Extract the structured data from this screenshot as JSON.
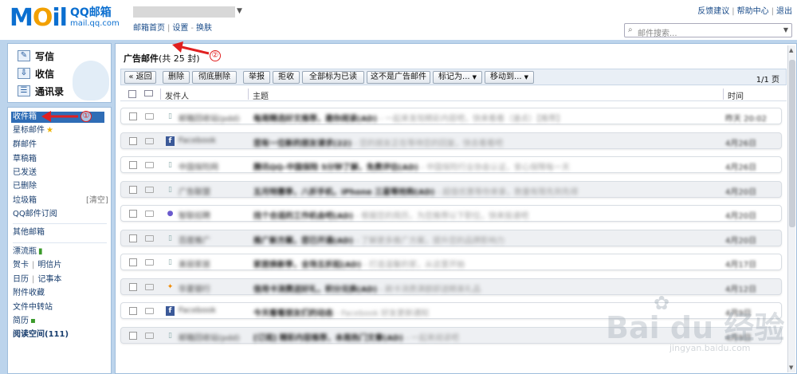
{
  "header": {
    "logo_mail": "M",
    "logo_o": "O",
    "logo_il": "il",
    "logo_cn": "QQ邮箱",
    "logo_domain": "mail.qq.com",
    "account_links": [
      "邮箱首页",
      "设置",
      "换肤"
    ],
    "top_links": [
      "反馈建议",
      "帮助中心",
      "退出"
    ],
    "search_placeholder": "邮件搜索..."
  },
  "sidebar": {
    "actions": [
      {
        "label": "写信",
        "icon": "compose-icon"
      },
      {
        "label": "收信",
        "icon": "inbox-download-icon"
      },
      {
        "label": "通讯录",
        "icon": "contacts-icon"
      }
    ],
    "folders": [
      {
        "label": "收件箱",
        "selected": true
      },
      {
        "label": "星标邮件",
        "icon": "star-icon"
      },
      {
        "label": "群邮件"
      },
      {
        "label": "草稿箱"
      },
      {
        "label": "已发送"
      },
      {
        "label": "已删除"
      },
      {
        "label": "垃圾箱",
        "extra": "[清空]"
      },
      {
        "label": "QQ邮件订阅"
      },
      {
        "label": "其他邮箱"
      },
      {
        "label": "漂流瓶",
        "icon": "bottle-icon"
      },
      {
        "label": "贺卡",
        "label2": "明信片"
      },
      {
        "label": "日历",
        "label2": "记事本"
      },
      {
        "label": "附件收藏"
      },
      {
        "label": "文件中转站"
      },
      {
        "label": "简历",
        "icon": "resume-icon"
      },
      {
        "label": "阅读空间(111)"
      }
    ]
  },
  "main": {
    "folder_title": "广告邮件",
    "folder_count": "(共 25 封)",
    "toolbar": {
      "back": "« 返回",
      "delete": "删除",
      "perm_delete": "彻底删除",
      "report": "举报",
      "reject": "拒收",
      "mark_all_read": "全部标为已读",
      "not_ad": "这不是广告邮件",
      "mark_as": "标记为...",
      "move_to": "移动到...",
      "pager": "1/1 页"
    },
    "columns": {
      "sender": "发件人",
      "subject": "主题",
      "time": "时间"
    },
    "rows": [
      {
        "sender": "邮箱回收站(pdd)",
        "subject": "每周精选好文推荐，邀你阅读(AD)",
        "preview": "一起来发现精彩内容吧，快来看看（速点）【推荐】",
        "time": "昨天 20:02",
        "icon": "doc-icon"
      },
      {
        "sender": "Facebook",
        "subject": "您有一位新的朋友请求(22)",
        "preview": "您的朋友正在等待您的回复，快去看看吧",
        "time": "4月26日",
        "icon": "facebook-icon"
      },
      {
        "sender": "中国保险网",
        "subject": "腾讯QQ-中国保险 5分钟了解，免费评估(AD)",
        "preview": "中国保险行业协会认证，安心保障每一天",
        "time": "4月26日",
        "icon": "doc-icon"
      },
      {
        "sender": "广告联盟",
        "subject": "五月特惠季，八折手机，iPhone 三星等抢购(AD)",
        "preview": "超值优惠等你来拿，数量有限先到先得",
        "time": "4月20日",
        "icon": "doc-icon"
      },
      {
        "sender": "智联招聘",
        "subject": "找个合适的工作机会吧(AD)",
        "preview": "根据您的简历，为您推荐以下职位，快来投递吧",
        "time": "4月20日",
        "icon": "circle-icon"
      },
      {
        "sender": "百度推广",
        "subject": "推广新方案，您已开通(AD)",
        "preview": "了解更多推广方案，提升您的品牌影响力",
        "time": "4月20日",
        "icon": "doc-icon"
      },
      {
        "sender": "美丽家居",
        "subject": "家居焕新季，全场五折起(AD)",
        "preview": "打造温馨的家，从这里开始",
        "time": "4月17日",
        "icon": "doc-icon"
      },
      {
        "sender": "华夏银行",
        "subject": "信用卡消费送好礼，积分兑换(AD)",
        "preview": "刷卡消费满额即送精美礼品",
        "time": "4月12日",
        "icon": "star-small-icon"
      },
      {
        "sender": "Facebook",
        "subject": "今天看看朋友们的动态",
        "preview": "Facebook 好友更新通知",
        "time": "4月9日",
        "icon": "facebook-icon"
      },
      {
        "sender": "邮箱回收站(pdd)",
        "subject": "[订阅] 精彩内容推荐，本周热门文章(AD)",
        "preview": "一起来阅读吧",
        "time": "4月9日",
        "icon": "doc-icon"
      }
    ]
  },
  "annotations": {
    "one": "①",
    "two": "②"
  },
  "watermark": {
    "big": "Bai du 经验",
    "small": "jingyan.baidu.com"
  },
  "colors": {
    "accent": "#2f6db6",
    "frame": "#bcd4ec",
    "arrow": "#e02020"
  }
}
